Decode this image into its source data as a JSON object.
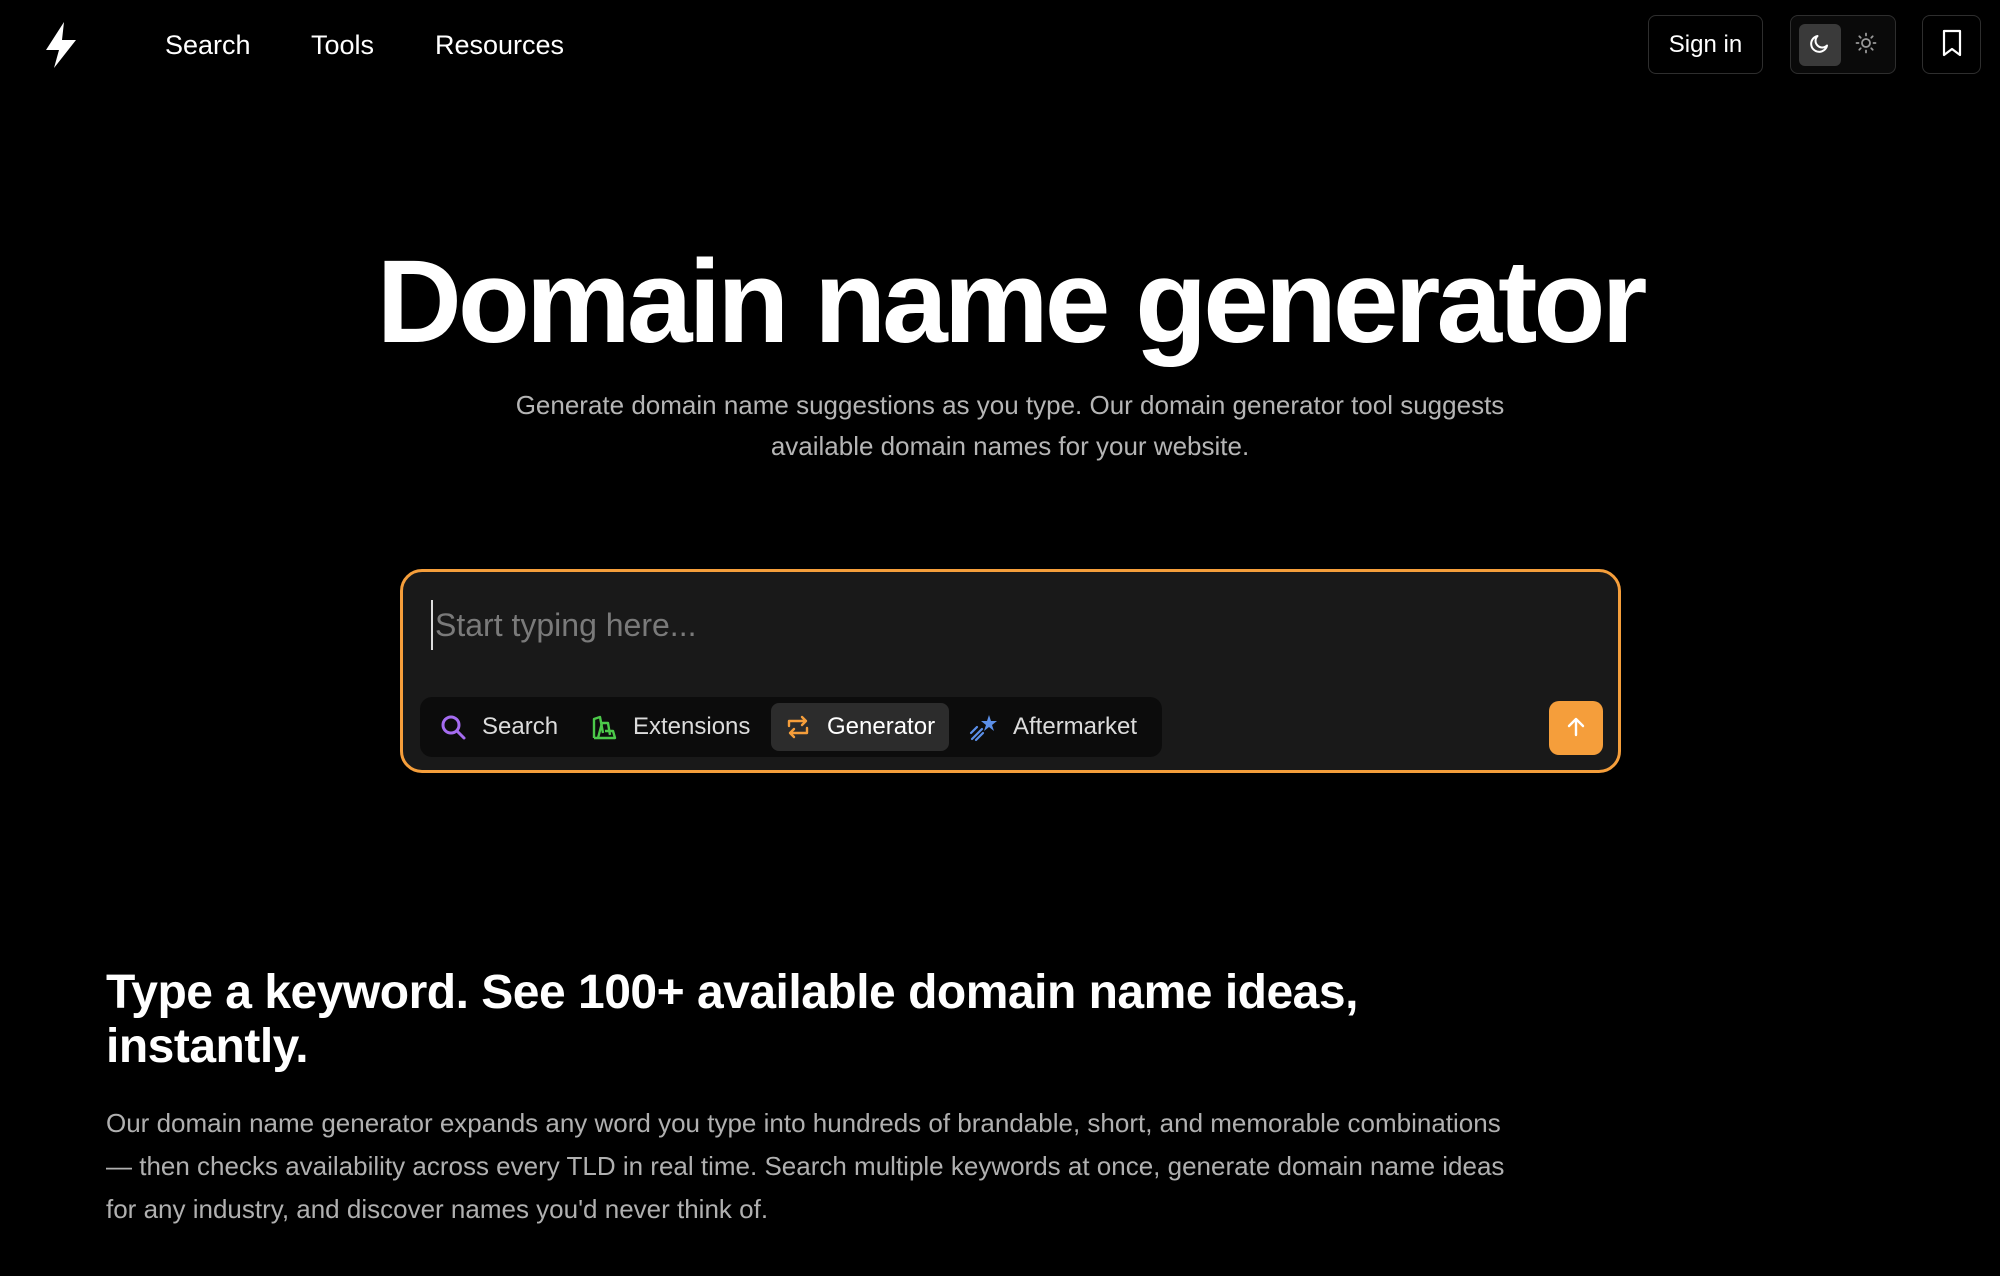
{
  "nav": {
    "links": [
      {
        "label": "Search"
      },
      {
        "label": "Tools"
      },
      {
        "label": "Resources"
      }
    ],
    "sign_in_label": "Sign in",
    "theme_options": [
      {
        "icon": "moon-icon",
        "active": true
      },
      {
        "icon": "sun-icon",
        "active": false
      }
    ],
    "bookmark_icon": "bookmark-icon"
  },
  "hero": {
    "title": "Domain name generator",
    "subtitle": "Generate domain name suggestions as you type. Our domain generator tool suggests available domain names for your website."
  },
  "search": {
    "placeholder": "Start typing here...",
    "value": "",
    "modes": [
      {
        "label": "Search",
        "icon": "search-icon",
        "active": false
      },
      {
        "label": "Extensions",
        "icon": "extensions-icon",
        "active": false
      },
      {
        "label": "Generator",
        "icon": "generator-icon",
        "active": true
      },
      {
        "label": "Aftermarket",
        "icon": "aftermarket-icon",
        "active": false
      }
    ],
    "submit_icon": "arrow-up-icon"
  },
  "section": {
    "heading": "Type a keyword. See 100+ available domain name ideas, instantly.",
    "body": "Our domain name generator expands any word you type into hundreds of brandable, short, and memorable combinations — then checks availability across every TLD in real time. Search multiple keywords at once, generate domain name ideas for any industry, and discover names you'd never think of."
  },
  "colors": {
    "background": "#000000",
    "accent": "#f59e3b",
    "search_icon": "#a56cf0",
    "extensions_icon": "#4cc94a",
    "generator_icon": "#f59e3b",
    "aftermarket_icon": "#5b8fe8"
  }
}
